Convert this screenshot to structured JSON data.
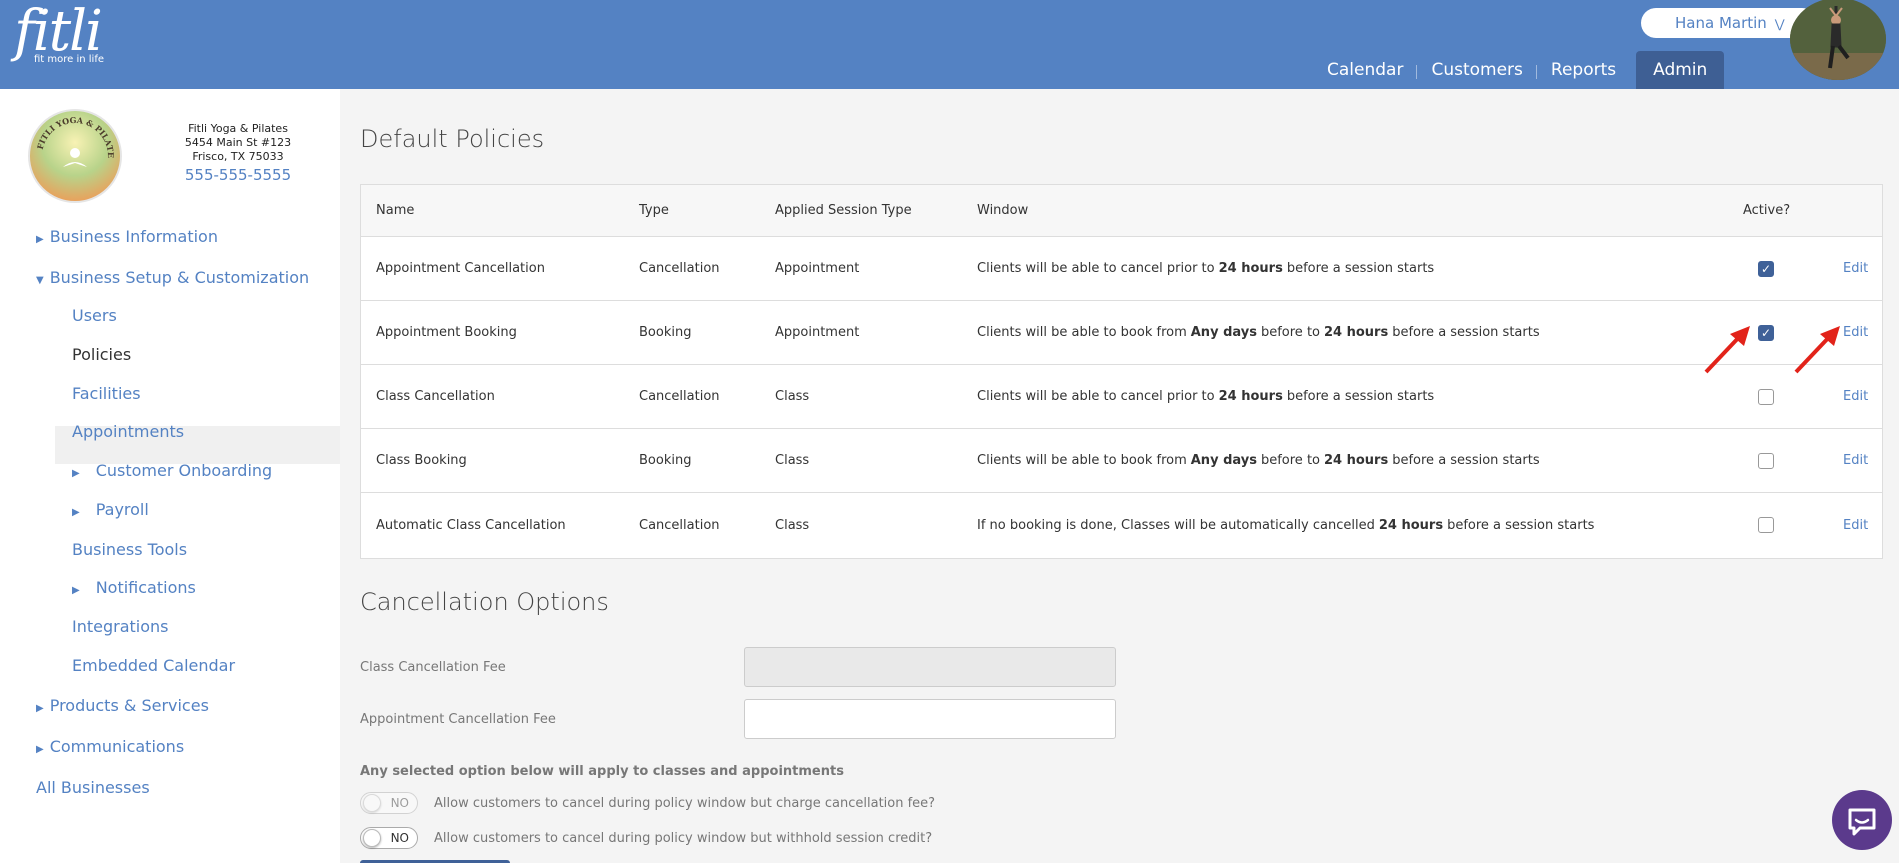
{
  "header": {
    "logo_word": "fitli",
    "logo_tagline": "fit more in life",
    "user_name": "Hana Martin",
    "nav": [
      "Calendar",
      "Customers",
      "Reports",
      "Admin"
    ]
  },
  "business": {
    "name": "Fitli Yoga & Pilates",
    "address1": "5454 Main St #123",
    "address2": "Frisco, TX 75033",
    "phone": "555-555-5555",
    "logo_text": "FITLI YOGA & PILATES"
  },
  "sidebar": {
    "items": [
      {
        "label": "Business Information"
      },
      {
        "label": "Business Setup & Customization"
      },
      {
        "label": "Users"
      },
      {
        "label": "Policies"
      },
      {
        "label": "Facilities"
      },
      {
        "label": "Appointments"
      },
      {
        "label": "Customer Onboarding"
      },
      {
        "label": "Payroll"
      },
      {
        "label": "Business Tools"
      },
      {
        "label": "Notifications"
      },
      {
        "label": "Integrations"
      },
      {
        "label": "Embedded Calendar"
      },
      {
        "label": "Products & Services"
      },
      {
        "label": "Communications"
      },
      {
        "label": "All Businesses"
      }
    ]
  },
  "policies": {
    "title": "Default Policies",
    "columns": [
      "Name",
      "Type",
      "Applied Session Type",
      "Window",
      "Active?"
    ],
    "edit_label": "Edit",
    "rows": [
      {
        "name": "Appointment Cancellation",
        "type": "Cancellation",
        "session": "Appointment",
        "w1": "Clients will be able to cancel prior to",
        "b1": "24 hours",
        "w2": "before a session starts",
        "active": true
      },
      {
        "name": "Appointment Booking",
        "type": "Booking",
        "session": "Appointment",
        "w1": "Clients will be able to book from",
        "b1": "Any days",
        "w2": "before to",
        "b2": "24 hours",
        "w3": "before a session starts",
        "active": true
      },
      {
        "name": "Class Cancellation",
        "type": "Cancellation",
        "session": "Class",
        "w1": "Clients will be able to cancel prior to",
        "b1": "24 hours",
        "w2": "before a session starts",
        "active": false
      },
      {
        "name": "Class Booking",
        "type": "Booking",
        "session": "Class",
        "w1": "Clients will be able to book from",
        "b1": "Any days",
        "w2": "before to",
        "b2": "24 hours",
        "w3": "before a session starts",
        "active": false
      },
      {
        "name": "Automatic Class Cancellation",
        "type": "Cancellation",
        "session": "Class",
        "w1": "If no booking is done, Classes will be automatically cancelled",
        "b1": "24 hours",
        "w2": "before a session starts",
        "active": false
      }
    ]
  },
  "cancellation": {
    "title": "Cancellation Options",
    "class_fee_label": "Class Cancellation Fee",
    "class_fee_value": "",
    "appt_fee_label": "Appointment Cancellation Fee",
    "appt_fee_value": "",
    "note": "Any selected option below will apply to classes and appointments",
    "toggles": [
      {
        "state": "NO",
        "label": "Allow customers to cancel during policy window but charge cancellation fee?"
      },
      {
        "state": "NO",
        "label": "Allow customers to cancel during policy window but withhold session credit?"
      }
    ]
  },
  "colors": {
    "header": "#5482c3",
    "admin_tab": "#3e5f94",
    "link": "#5482c3",
    "chat": "#5b3a8c",
    "arrow": "#e2231a"
  }
}
